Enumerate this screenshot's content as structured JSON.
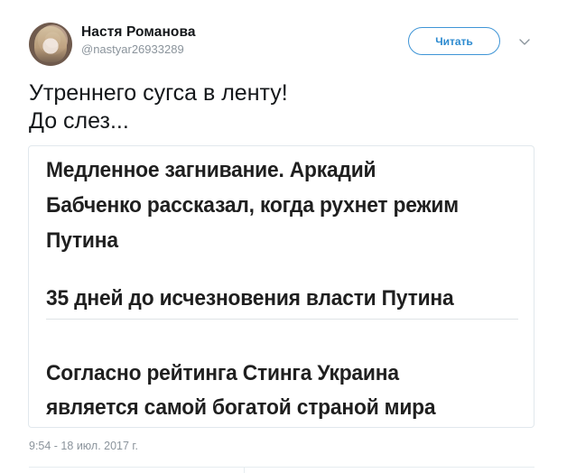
{
  "tweet": {
    "author_name": "Настя Романова",
    "author_handle": "@nastyar26933289",
    "follow_label": "Читать",
    "text_lines": [
      "Утреннего сугса в ленту!",
      "До слез..."
    ],
    "timestamp": "9:54 - 18 июл. 2017 г."
  },
  "card": {
    "headline": "Медленное загнивание. Аркадий Бабченко рассказал, когда рухнет режим Путина",
    "item2": "35 дней до исчезновения власти Путина",
    "item3_line1": "Согласно рейтинга Стинга Украина",
    "item3_line2": "является самой богатой страной мира",
    "headline_line1": "Медленное загнивание. Аркадий",
    "headline_line2": "Бабченко рассказал, когда рухнет режим",
    "headline_line3": "Путина"
  },
  "colors": {
    "accent": "#2d8bd0",
    "muted": "#8b949c",
    "border": "#e1e8ed"
  },
  "icons": {
    "avatar": "profile-photo",
    "caret": "chevron-down-icon"
  }
}
